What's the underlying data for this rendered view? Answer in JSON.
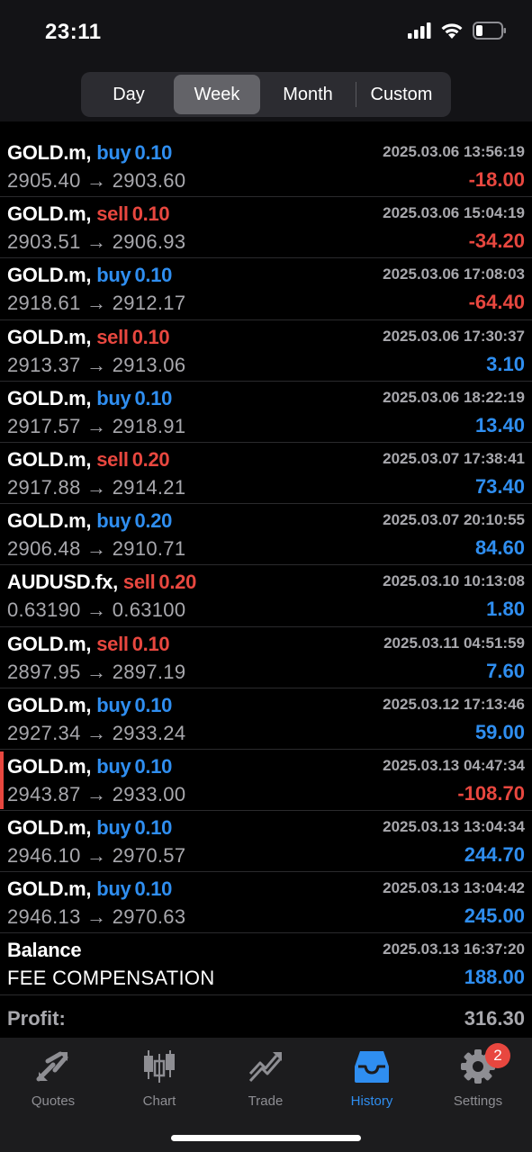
{
  "status_bar": {
    "time": "23:11"
  },
  "segment": {
    "items": [
      {
        "label": "Day",
        "active": false
      },
      {
        "label": "Week",
        "active": true
      },
      {
        "label": "Month",
        "active": false
      },
      {
        "label": "Custom",
        "active": false
      }
    ]
  },
  "trades": [
    {
      "symbol": "GOLD.m,",
      "side": "buy",
      "volume": "0.10",
      "open": "2905.40",
      "close": "2903.60",
      "time": "2025.03.06 13:56:19",
      "profit": "-18.00"
    },
    {
      "symbol": "GOLD.m,",
      "side": "sell",
      "volume": "0.10",
      "open": "2903.51",
      "close": "2906.93",
      "time": "2025.03.06 15:04:19",
      "profit": "-34.20"
    },
    {
      "symbol": "GOLD.m,",
      "side": "buy",
      "volume": "0.10",
      "open": "2918.61",
      "close": "2912.17",
      "time": "2025.03.06 17:08:03",
      "profit": "-64.40"
    },
    {
      "symbol": "GOLD.m,",
      "side": "sell",
      "volume": "0.10",
      "open": "2913.37",
      "close": "2913.06",
      "time": "2025.03.06 17:30:37",
      "profit": "3.10"
    },
    {
      "symbol": "GOLD.m,",
      "side": "buy",
      "volume": "0.10",
      "open": "2917.57",
      "close": "2918.91",
      "time": "2025.03.06 18:22:19",
      "profit": "13.40"
    },
    {
      "symbol": "GOLD.m,",
      "side": "sell",
      "volume": "0.20",
      "open": "2917.88",
      "close": "2914.21",
      "time": "2025.03.07 17:38:41",
      "profit": "73.40"
    },
    {
      "symbol": "GOLD.m,",
      "side": "buy",
      "volume": "0.20",
      "open": "2906.48",
      "close": "2910.71",
      "time": "2025.03.07 20:10:55",
      "profit": "84.60"
    },
    {
      "symbol": "AUDUSD.fx,",
      "side": "sell",
      "volume": "0.20",
      "open": "0.63190",
      "close": "0.63100",
      "time": "2025.03.10 10:13:08",
      "profit": "1.80"
    },
    {
      "symbol": "GOLD.m,",
      "side": "sell",
      "volume": "0.10",
      "open": "2897.95",
      "close": "2897.19",
      "time": "2025.03.11 04:51:59",
      "profit": "7.60"
    },
    {
      "symbol": "GOLD.m,",
      "side": "buy",
      "volume": "0.10",
      "open": "2927.34",
      "close": "2933.24",
      "time": "2025.03.12 17:13:46",
      "profit": "59.00"
    },
    {
      "symbol": "GOLD.m,",
      "side": "buy",
      "volume": "0.10",
      "open": "2943.87",
      "close": "2933.00",
      "time": "2025.03.13 04:47:34",
      "profit": "-108.70",
      "marked": true
    },
    {
      "symbol": "GOLD.m,",
      "side": "buy",
      "volume": "0.10",
      "open": "2946.10",
      "close": "2970.57",
      "time": "2025.03.13 13:04:34",
      "profit": "244.70"
    },
    {
      "symbol": "GOLD.m,",
      "side": "buy",
      "volume": "0.10",
      "open": "2946.13",
      "close": "2970.63",
      "time": "2025.03.13 13:04:42",
      "profit": "245.00"
    }
  ],
  "balance": {
    "label": "Balance",
    "comment": "FEE COMPENSATION",
    "time": "2025.03.13 16:37:20",
    "amount": "188.00"
  },
  "profit": {
    "label": "Profit:",
    "value": "316.30"
  },
  "tabs": [
    {
      "label": "Quotes",
      "icon": "quotes-icon",
      "active": false
    },
    {
      "label": "Chart",
      "icon": "chart-icon",
      "active": false
    },
    {
      "label": "Trade",
      "icon": "trade-icon",
      "active": false
    },
    {
      "label": "History",
      "icon": "history-icon",
      "active": true
    },
    {
      "label": "Settings",
      "icon": "settings-icon",
      "active": false,
      "badge": "2"
    }
  ],
  "colors": {
    "buy": "#2f8ef0",
    "sell": "#e8473f",
    "profit_positive": "#2f8ef0",
    "profit_negative": "#e8473f",
    "accent": "#2f8ef0"
  }
}
